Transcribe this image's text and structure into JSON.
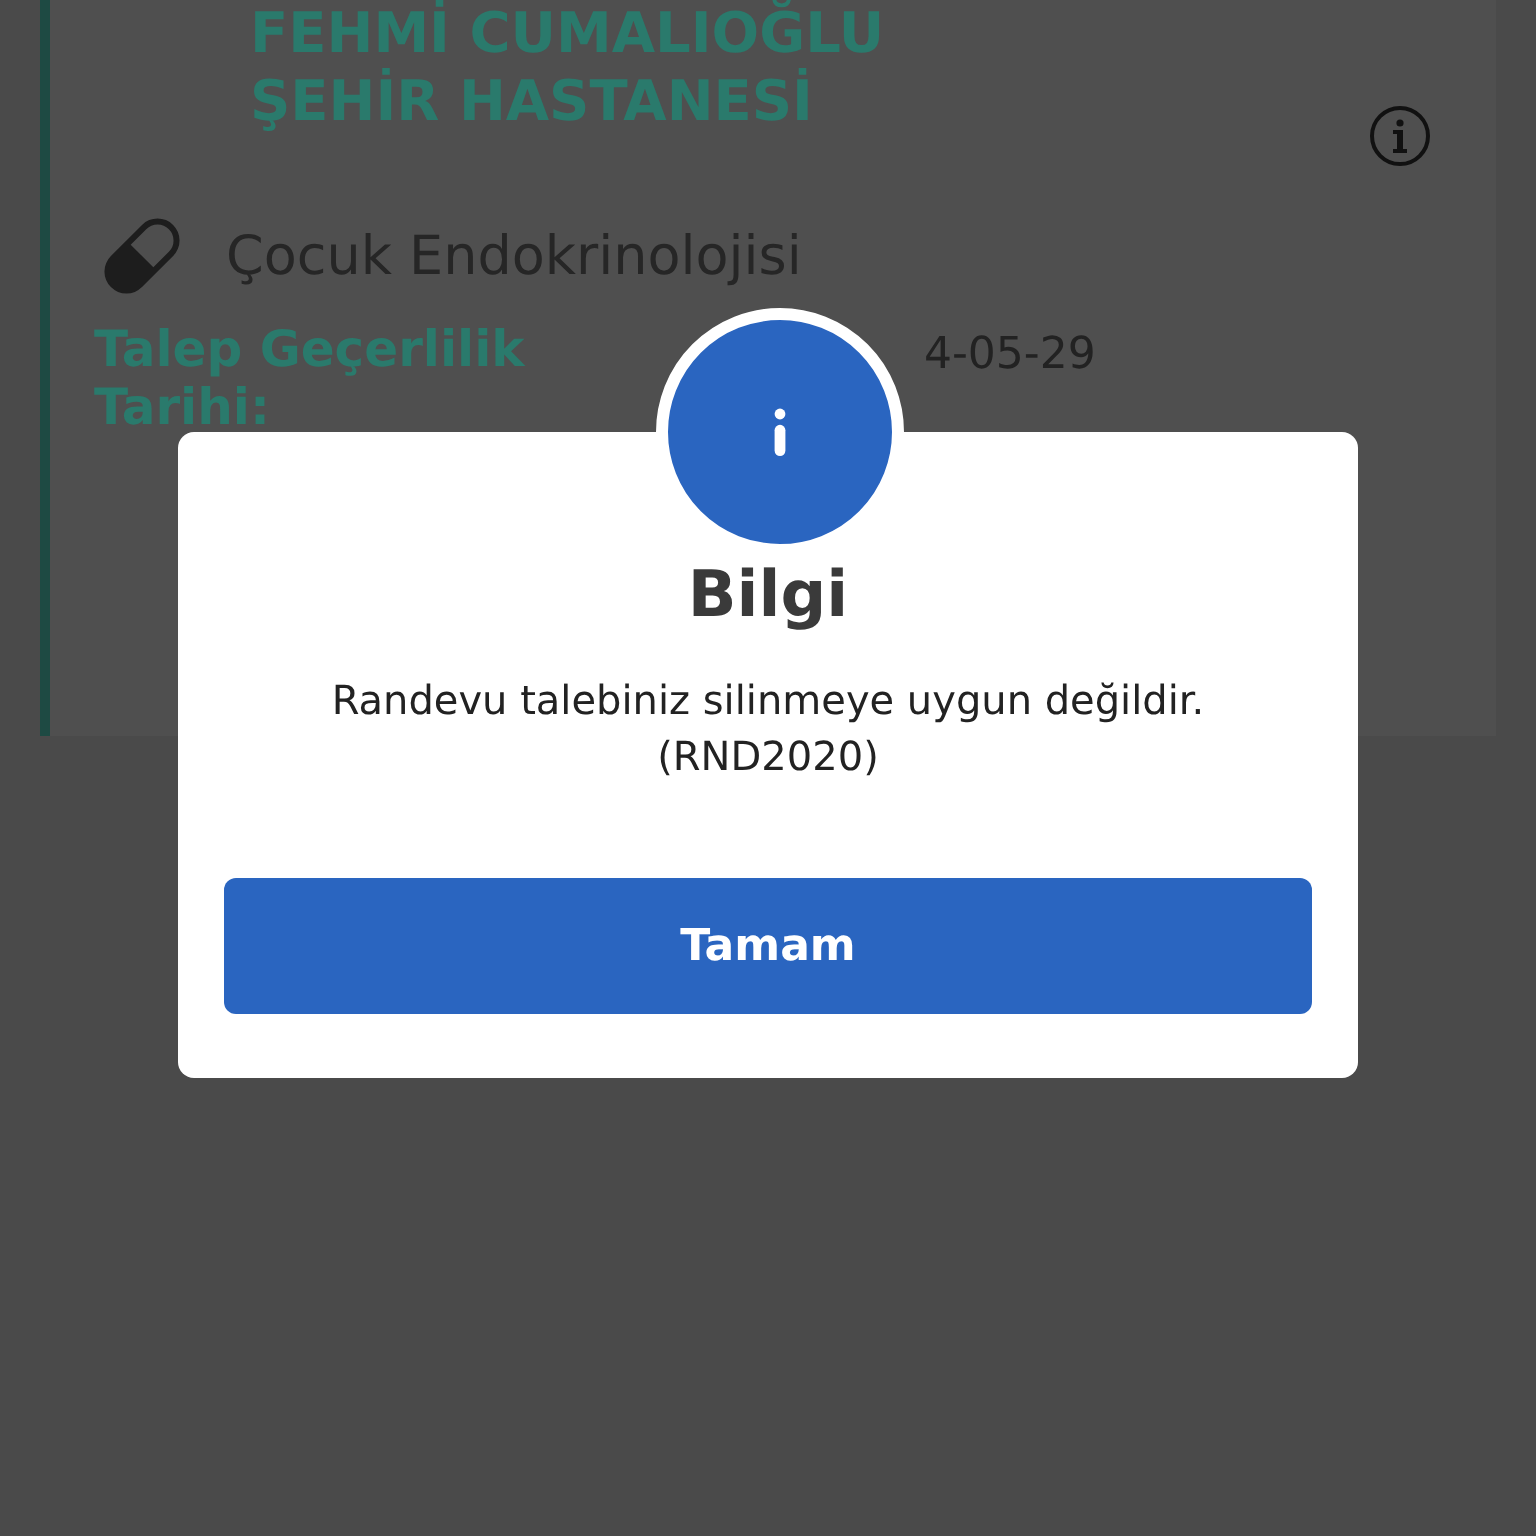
{
  "card": {
    "hospital_name": [
      "FEHMİ CUMALIOĞLU",
      "ŞEHİR HASTANESİ"
    ],
    "department": "Çocuk Endokrinolojisi",
    "validity_label": "Talep Geçerlilik Tarihi:",
    "validity_date": "4-05-29"
  },
  "dialog": {
    "title": "Bilgi",
    "message": "Randevu talebiniz silinmeye uygun değildir. (RND2020)",
    "buttons": [
      "Tamam"
    ]
  }
}
